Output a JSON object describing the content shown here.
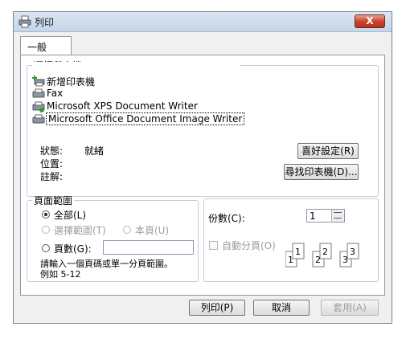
{
  "window": {
    "title": "列印",
    "close_label": "X"
  },
  "tabs": [
    {
      "label": "一般"
    }
  ],
  "printer_group": {
    "legend": "選擇印表機",
    "printers": [
      {
        "label": "新增印表機",
        "icon": "add-printer-icon"
      },
      {
        "label": "Fax",
        "icon": "fax-icon"
      },
      {
        "label": "Microsoft XPS Document Writer",
        "icon": "printer-icon"
      },
      {
        "label": "Microsoft Office Document Image Writer",
        "icon": "printer-icon"
      }
    ],
    "selected_index": 3,
    "status_label": "狀態:",
    "status_value": "就緒",
    "location_label": "位置:",
    "comment_label": "註解:",
    "preferences_button": "喜好設定(R)",
    "find_printer_button": "尋找印表機(D)..."
  },
  "page_range": {
    "legend": "頁面範圍",
    "all_label": "全部(L)",
    "selection_label": "選擇範圍(T)",
    "current_page_label": "本頁(U)",
    "pages_label": "頁數(G):",
    "pages_value": "",
    "hint_line1": "請輸入一個頁碼或單一分頁範圍。",
    "hint_line2": "例如 5-12",
    "selected": "all"
  },
  "copies": {
    "label": "份數(C):",
    "value": "1",
    "collate_label": "自動分頁(O)",
    "collate_checked": false,
    "collate_images": [
      "1",
      "1",
      "2",
      "2",
      "3",
      "3"
    ]
  },
  "footer": {
    "print_button": "列印(P)",
    "cancel_button": "取消",
    "apply_button": "套用(A)"
  }
}
